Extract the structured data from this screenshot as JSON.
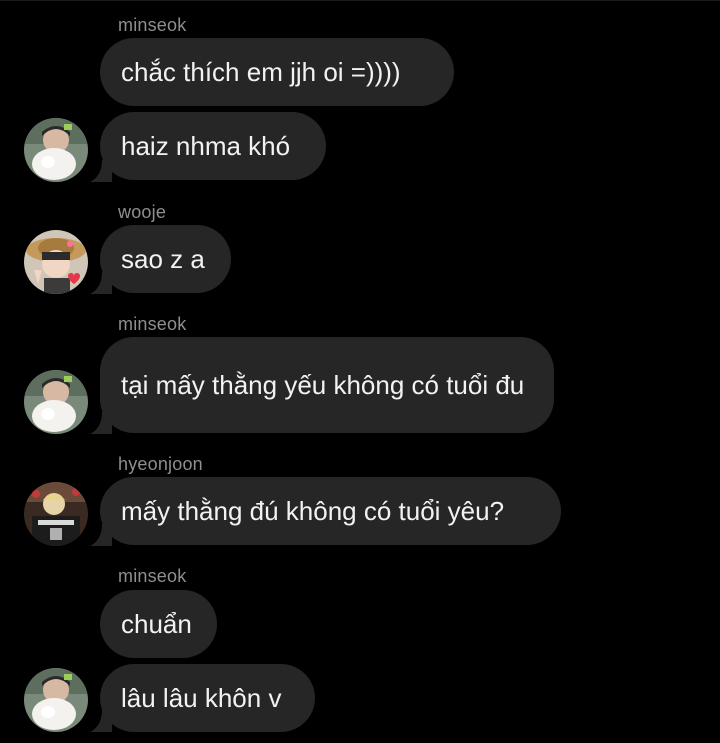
{
  "messages": [
    {
      "sender": "minseok",
      "text": "chắc thích em jjh oi =))))"
    },
    {
      "sender": "",
      "text": "haiz nhma khó",
      "avatar": "minseok-avatar"
    },
    {
      "sender": "wooje",
      "text": "sao z a",
      "avatar": "wooje-avatar"
    },
    {
      "sender": "minseok",
      "text": "tại mấy thằng yếu không có tuổi đu",
      "avatar": "minseok-avatar"
    },
    {
      "sender": "hyeonjoon",
      "text": "mấy thằng đú không có tuổi yêu?",
      "avatar": "hyeonjoon-avatar"
    },
    {
      "sender": "minseok",
      "text": "chuẩn"
    },
    {
      "sender": "",
      "text": "lâu lâu khôn v",
      "avatar": "minseok-avatar"
    }
  ],
  "colors": {
    "background": "#000000",
    "bubble": "#262626",
    "text": "#f2f2f2",
    "sender_name": "#8e8e93"
  }
}
